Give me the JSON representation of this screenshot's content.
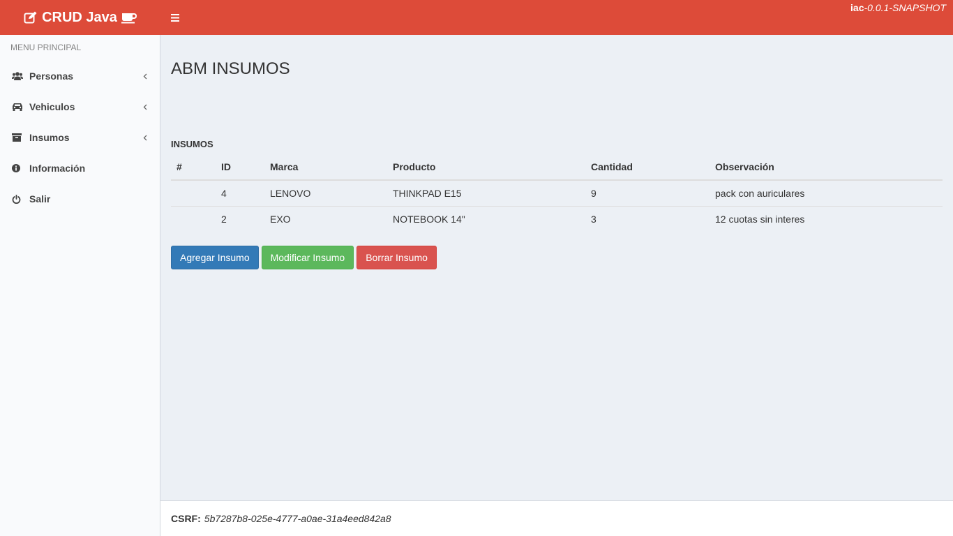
{
  "header": {
    "logo_text": "CRUD Java",
    "version_prefix": "iac",
    "version_suffix": "-0.0.1-SNAPSHOT",
    "brand_color": "#dd4b39"
  },
  "sidebar": {
    "menu_header": "MENU PRINCIPAL",
    "items": [
      {
        "label": "Personas",
        "icon": "users-icon",
        "has_submenu": true
      },
      {
        "label": "Vehiculos",
        "icon": "car-icon",
        "has_submenu": true
      },
      {
        "label": "Insumos",
        "icon": "archive-icon",
        "has_submenu": true
      },
      {
        "label": "Información",
        "icon": "info-circle-icon",
        "has_submenu": false
      },
      {
        "label": "Salir",
        "icon": "power-off-icon",
        "has_submenu": false
      }
    ]
  },
  "main": {
    "page_title": "ABM INSUMOS",
    "section_title": "INSUMOS",
    "table": {
      "columns": [
        "#",
        "ID",
        "Marca",
        "Producto",
        "Cantidad",
        "Observación"
      ],
      "rows": [
        [
          "",
          "4",
          "LENOVO",
          "THINKPAD E15",
          "9",
          "pack con auriculares"
        ],
        [
          "",
          "2",
          "EXO",
          "NOTEBOOK 14\"",
          "3",
          "12 cuotas sin interes"
        ]
      ]
    },
    "buttons": {
      "add": "Agregar Insumo",
      "modify": "Modificar Insumo",
      "delete": "Borrar Insumo"
    }
  },
  "footer": {
    "csrf_label": "CSRF:",
    "csrf_value": "5b7287b8-025e-4777-a0ae-31a4eed842a8"
  }
}
